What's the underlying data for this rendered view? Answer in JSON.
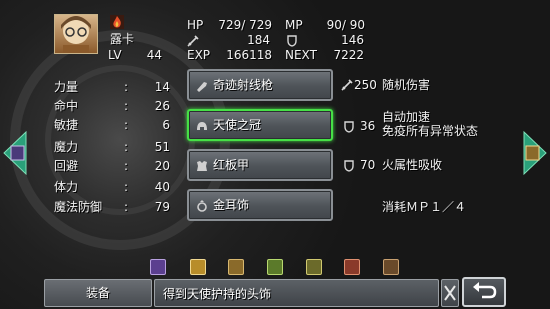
{
  "character": {
    "name": "露卡",
    "level_label": "LV",
    "level": "44",
    "hp_label": "HP",
    "hp_value": "729/ 729",
    "mp_label": "MP",
    "mp_value": "90/ 90",
    "attack": "184",
    "defense": "146",
    "exp_label": "EXP",
    "exp": "166118",
    "next_label": "NEXT",
    "next": "7222"
  },
  "stats": [
    {
      "label": "力量",
      "value": "14"
    },
    {
      "label": "命中",
      "value": "26"
    },
    {
      "label": "敏捷",
      "value": "6"
    },
    {
      "label": "魔力",
      "value": "51"
    },
    {
      "label": "回避",
      "value": "20"
    },
    {
      "label": "体力",
      "value": "40"
    },
    {
      "label": "魔法防御",
      "value": "79"
    }
  ],
  "colon": ":",
  "equipment": [
    {
      "name": "奇迹射线枪",
      "icon": "gun-icon",
      "effect_value": "250",
      "effect_text": "随机伤害",
      "effect_icon": "sword-icon"
    },
    {
      "name": "天使之冠",
      "icon": "helmet-icon",
      "effect_value": "36",
      "effect_line1": "自动加速",
      "effect_line2": "免疫所有异常状态",
      "effect_icon": "shield-icon"
    },
    {
      "name": "红板甲",
      "icon": "armor-icon",
      "effect_value": "70",
      "effect_text": "火属性吸收",
      "effect_icon": "shield-icon"
    },
    {
      "name": "金耳饰",
      "icon": "ring-icon",
      "effect_text": "消耗ＭＰ１／４"
    }
  ],
  "item_tray": [
    {
      "icon": "purple-gem-icon",
      "color": "#5b3f8f"
    },
    {
      "icon": "gold-item-icon",
      "color": "#b88d2a"
    },
    {
      "icon": "bronze-item-icon",
      "color": "#8a6a2a"
    },
    {
      "icon": "green-item-icon",
      "color": "#5b7a2a"
    },
    {
      "icon": "olive-item-icon",
      "color": "#6b6a2a"
    },
    {
      "icon": "red-item-icon",
      "color": "#8a3a2a"
    },
    {
      "icon": "brown-item-icon",
      "color": "#6a4a2a"
    }
  ],
  "bottom": {
    "equip_label": "装备",
    "description": "得到天使护持的头饰"
  },
  "colors": {
    "selected_border": "#46e046",
    "left_arrow": "#2aa07a",
    "right_arrow": "#2aa07a"
  }
}
